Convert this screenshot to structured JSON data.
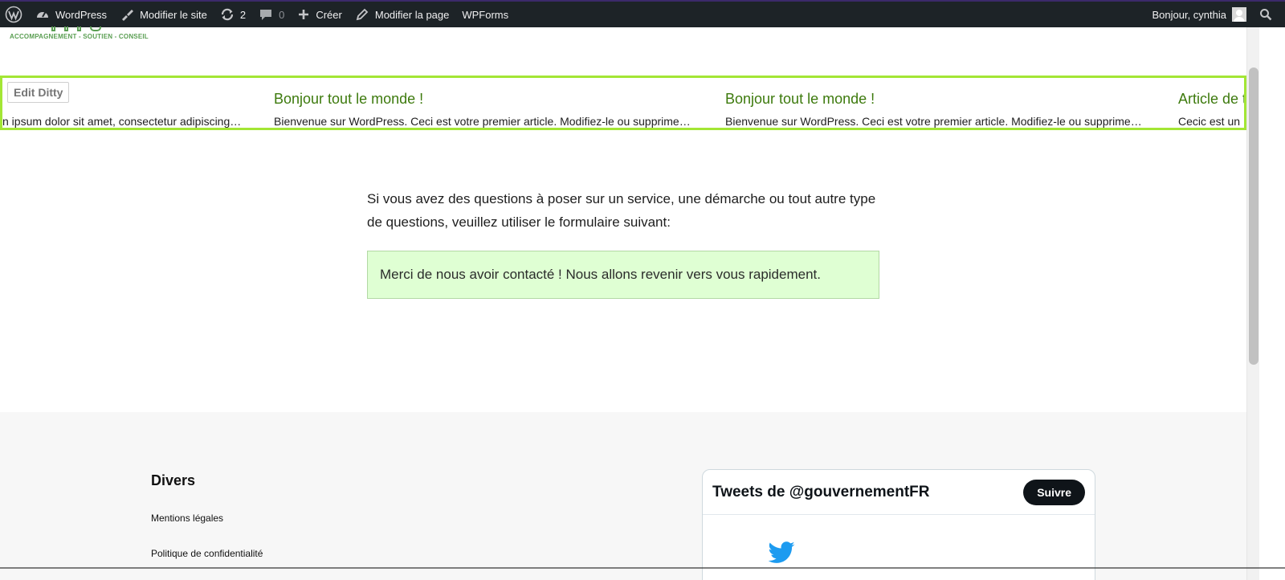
{
  "adminbar": {
    "site_name": "WordPress",
    "customize": "Modifier le site",
    "updates_count": "2",
    "comments_count": "0",
    "new": "Créer",
    "edit_page": "Modifier la page",
    "wpforms": "WPForms",
    "greeting": "Bonjour, cynthia"
  },
  "site": {
    "tagline": "ACCOMPAGNEMENT - SOUTIEN - CONSEIL"
  },
  "ditty": {
    "edit_label": "Edit Ditty",
    "items": [
      {
        "title": "",
        "excerpt": "n ipsum dolor sit amet, consectetur adipiscing…"
      },
      {
        "title": "Bonjour tout le monde !",
        "excerpt": "Bienvenue sur WordPress. Ceci est votre premier article. Modifiez-le ou supprime…"
      },
      {
        "title": "Bonjour tout le monde !",
        "excerpt": "Bienvenue sur WordPress. Ceci est votre premier article. Modifiez-le ou supprime…"
      },
      {
        "title": "Article de t",
        "excerpt": "Cecic est un"
      }
    ]
  },
  "content": {
    "intro": "Si vous avez des questions à poser sur un service, une démarche ou tout autre type de questions, veuillez utiliser le formulaire suivant:",
    "confirmation": "Merci de nous avoir contacté ! Nous allons revenir vers vous rapidement."
  },
  "footer": {
    "heading": "Divers",
    "links": [
      "Mentions légales",
      "Politique de confidentialité"
    ],
    "twitter": {
      "title": "Tweets de @gouvernementFR",
      "follow": "Suivre"
    }
  },
  "colors": {
    "adminbar_bg": "#1d2327",
    "ditty_border": "#a3e635",
    "ditty_title": "#3d7a0d",
    "confirm_bg": "#dfffd3",
    "twitter_blue": "#1d9bf0"
  }
}
